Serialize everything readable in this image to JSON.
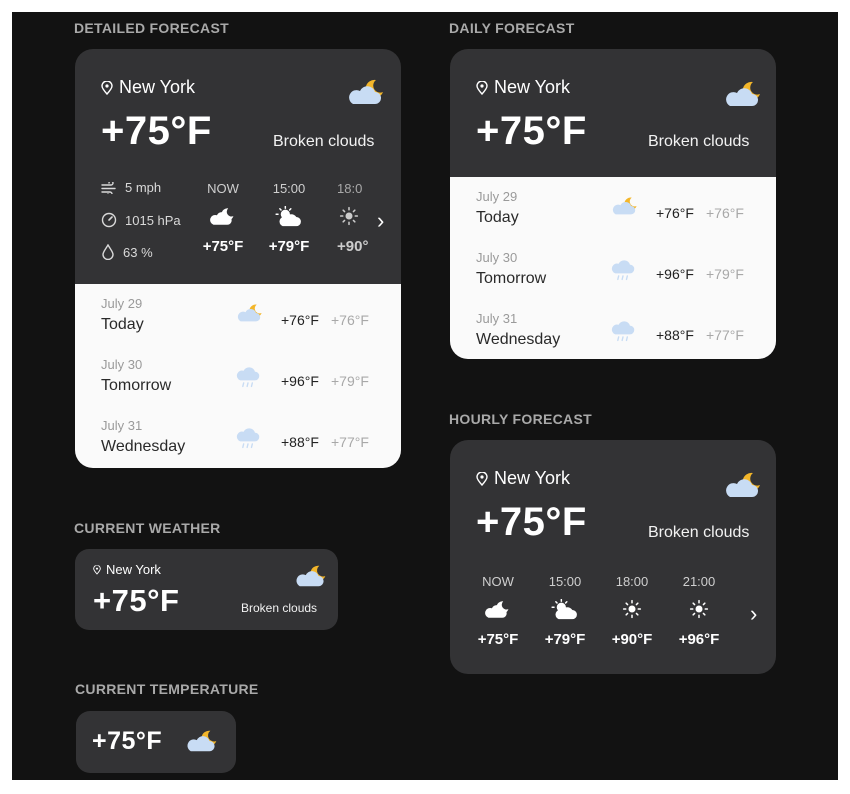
{
  "sections": {
    "detailed": "DETAILED FORECAST",
    "daily": "DAILY FORECAST",
    "hourly": "HOURLY FORECAST",
    "current_weather": "CURRENT WEATHER",
    "current_temperature": "CURRENT TEMPERATURE"
  },
  "location": "New York",
  "current": {
    "temp": "+75°F",
    "condition": "Broken clouds"
  },
  "stats": {
    "wind": "5 mph",
    "pressure": "1015 hPa",
    "humidity": "63 %"
  },
  "detailed_hours": [
    {
      "time": "NOW",
      "temp": "+75°F",
      "icon": "moon-cloud-icon"
    },
    {
      "time": "15:00",
      "temp": "+79°F",
      "icon": "sun-cloud-icon"
    },
    {
      "time": "18:0",
      "temp": "+90°",
      "icon": "sun-icon"
    }
  ],
  "hourly_hours": [
    {
      "time": "NOW",
      "temp": "+75°F",
      "icon": "moon-cloud-icon"
    },
    {
      "time": "15:00",
      "temp": "+79°F",
      "icon": "sun-cloud-icon"
    },
    {
      "time": "18:00",
      "temp": "+90°F",
      "icon": "sun-icon"
    },
    {
      "time": "21:00",
      "temp": "+96°F",
      "icon": "sun-icon"
    }
  ],
  "days": [
    {
      "date": "July 29",
      "name": "Today",
      "hi": "+76°F",
      "lo": "+76°F",
      "icon": "moon-cloud-icon"
    },
    {
      "date": "July 30",
      "name": "Tomorrow",
      "hi": "+96°F",
      "lo": "+79°F",
      "icon": "rain-cloud-icon"
    },
    {
      "date": "July 31",
      "name": "Wednesday",
      "hi": "+88°F",
      "lo": "+77°F",
      "icon": "rain-cloud-icon"
    }
  ],
  "colors": {
    "board": "#121212",
    "card": "#333335",
    "moon": "#f3b62a",
    "cloud": "#c8dcf4"
  }
}
